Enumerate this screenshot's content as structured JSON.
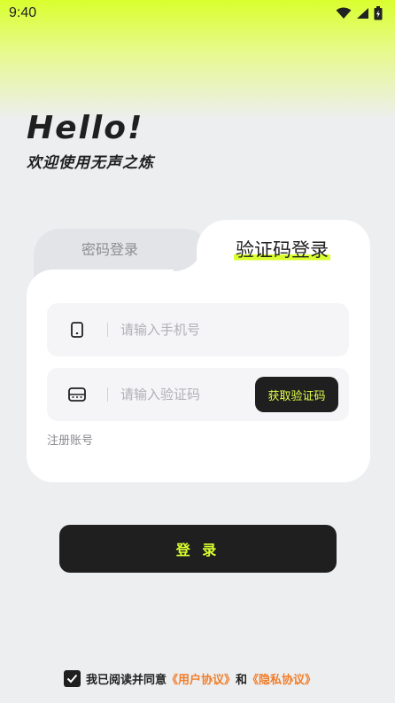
{
  "status_bar": {
    "time": "9:40"
  },
  "hero": {
    "title": "Hello!",
    "subtitle": "欢迎使用无声之炼"
  },
  "tabs": {
    "password": "密码登录",
    "code": "验证码登录"
  },
  "form": {
    "phone_placeholder": "请输入手机号",
    "code_placeholder": "请输入验证码",
    "get_code": "获取验证码",
    "register": "注册账号"
  },
  "login_button": "登 录",
  "agreement": {
    "prefix": "我已阅读并同意",
    "user_agreement": "《用户协议》",
    "and": "和",
    "privacy_agreement": "《隐私协议》"
  },
  "colors": {
    "accent": "#d9ff2e",
    "dark": "#1f1f1f",
    "link": "#f07d2a"
  }
}
